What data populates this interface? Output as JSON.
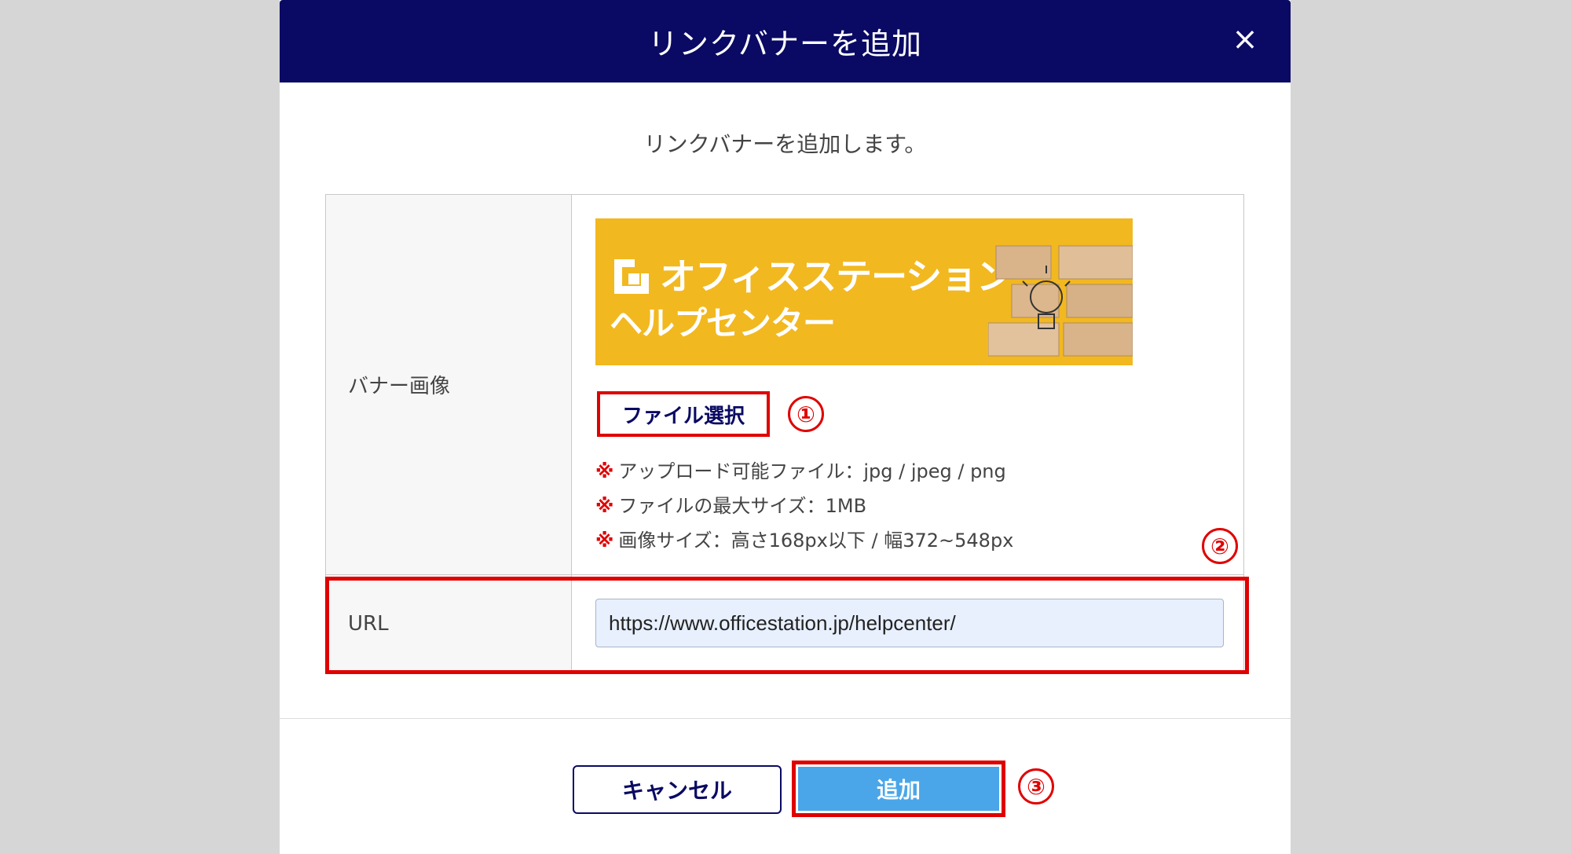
{
  "modal": {
    "title": "リンクバナーを追加",
    "close_icon": "×",
    "subtitle": "リンクバナーを追加します。"
  },
  "banner_row": {
    "label": "バナー画像",
    "banner_image": {
      "line1": "オフィスステーション",
      "line2": "ヘルプセンター",
      "background_color": "#f2b81f"
    },
    "file_button_label": "ファイル選択",
    "notes": [
      {
        "mark": "※",
        "text": "アップロード可能ファイル：jpg / jpeg / png"
      },
      {
        "mark": "※",
        "text": "ファイルの最大サイズ：1MB"
      },
      {
        "mark": "※",
        "text": "画像サイズ：高さ168px以下 / 幅372~548px"
      }
    ]
  },
  "url_row": {
    "label": "URL",
    "value": "https://www.officestation.jp/helpcenter/"
  },
  "footer": {
    "cancel_label": "キャンセル",
    "add_label": "追加"
  },
  "callouts": {
    "one": "①",
    "two": "②",
    "three": "③"
  },
  "colors": {
    "header": "#0a0a64",
    "highlight": "#e00000",
    "primary_button": "#4aa6e8"
  }
}
